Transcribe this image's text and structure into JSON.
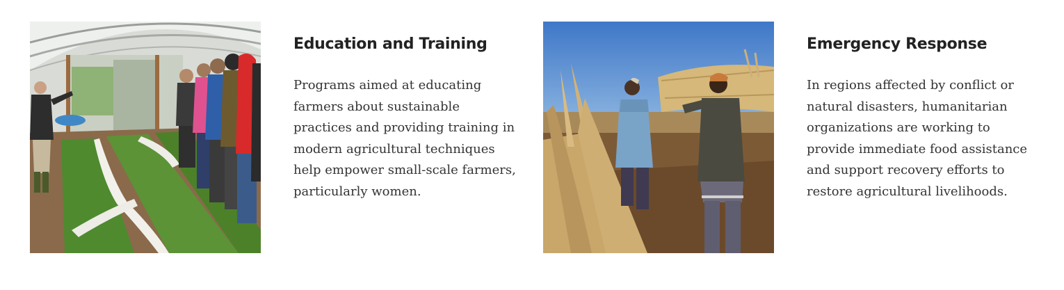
{
  "cards": [
    {
      "title": "Education and Training",
      "description": "Programs aimed at educating farmers about sustainable practices and providing training in modern agricultural techniques help empower small-scale farmers, particularly women.",
      "image": "greenhouse-training-photo"
    },
    {
      "title": "Emergency Response",
      "description": "In regions affected by conflict or natural disasters, humanitarian organizations are working to provide immediate food assistance and support recovery efforts to restore agricultural livelihoods.",
      "image": "farmers-carrying-harvest-photo"
    }
  ]
}
